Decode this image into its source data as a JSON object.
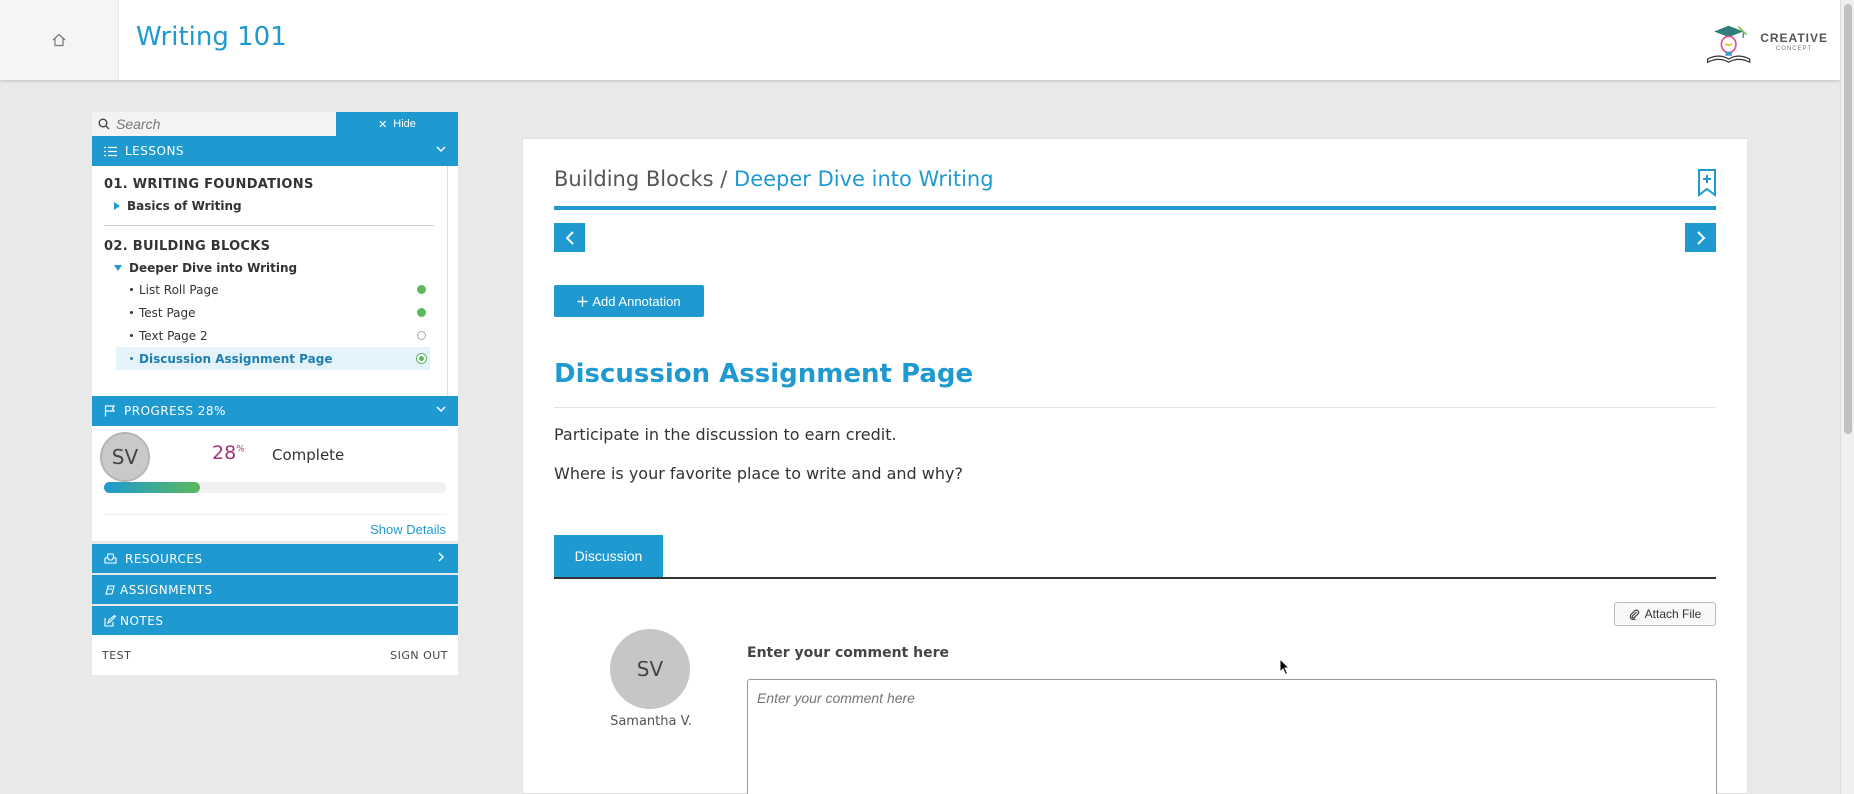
{
  "header": {
    "app_title": "Writing 101",
    "logo_text_main": "CREATIVE",
    "logo_text_sub": "CONCEPT"
  },
  "sidebar": {
    "search_placeholder": "Search",
    "hide_label": "Hide",
    "lessons_label": "LESSONS",
    "units": [
      {
        "title": "01. WRITING FOUNDATIONS",
        "lessons": [
          {
            "label": "Basics of Writing",
            "expanded": false
          }
        ]
      },
      {
        "title": "02. BUILDING BLOCKS",
        "lessons": [
          {
            "label": "Deeper Dive into Writing",
            "expanded": true,
            "pages": [
              {
                "label": "List Roll Page",
                "status": "complete"
              },
              {
                "label": "Test Page",
                "status": "complete"
              },
              {
                "label": "Text Page 2",
                "status": "incomplete"
              },
              {
                "label": "Discussion Assignment Page",
                "status": "current"
              }
            ]
          }
        ]
      }
    ],
    "progress_label": "PROGRESS 28%",
    "progress": {
      "avatar_initials": "SV",
      "percent_value": "28",
      "percent_sign": "%",
      "fraction": 0.28,
      "complete_label": "Complete",
      "show_details": "Show Details"
    },
    "resources_label": "RESOURCES",
    "assignments_label": "ASSIGNMENTS",
    "notes_label": "NOTES",
    "footer": {
      "left": "TEST",
      "right": "SIGN OUT"
    }
  },
  "main": {
    "breadcrumb_parent": "Building Blocks /",
    "breadcrumb_current": "Deeper Dive into Writing",
    "add_annotation_label": "Add Annotation",
    "page_title": "Discussion Assignment Page",
    "paragraphs": [
      "Participate in the discussion to earn credit.",
      "Where is your favorite place to write and and why?"
    ],
    "tab_label": "Discussion",
    "attach_label": "Attach File",
    "avatar_initials": "SV",
    "avatar_name": "Samantha V.",
    "comment_label": "Enter your comment here",
    "comment_placeholder": "Enter your comment here"
  },
  "colors": {
    "accent": "#1e9ad1",
    "progress_pct": "#a0337a",
    "status_complete": "#5cb85c"
  }
}
